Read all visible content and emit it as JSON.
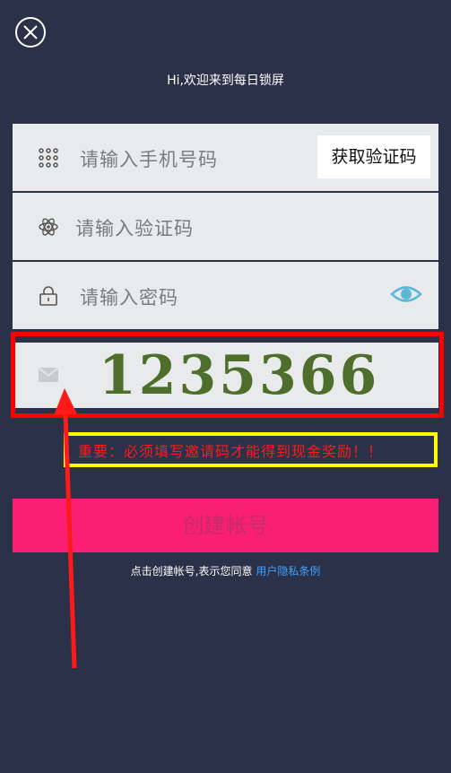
{
  "header": {
    "greeting": "Hi,欢迎来到每日锁屏"
  },
  "form": {
    "phone_placeholder": "请输入手机号码",
    "get_code_label": "获取验证码",
    "code_placeholder": "请输入验证码",
    "password_placeholder": "请输入密码",
    "invite_value": "1235366"
  },
  "annotation": {
    "notice": "重要：必须填写邀请码才能得到现金奖励！！",
    "colors": {
      "red_box": "#ff0000",
      "yellow_box": "#ffff00",
      "arrow": "#ff0000"
    }
  },
  "actions": {
    "create_label": "创建帐号",
    "agree_text": "点击创建帐号,表示您同意 ",
    "agree_link": "用户隐私条例"
  },
  "theme": {
    "background": "#2b3148",
    "accent": "#fb1f73",
    "link": "#3fa0ff"
  }
}
